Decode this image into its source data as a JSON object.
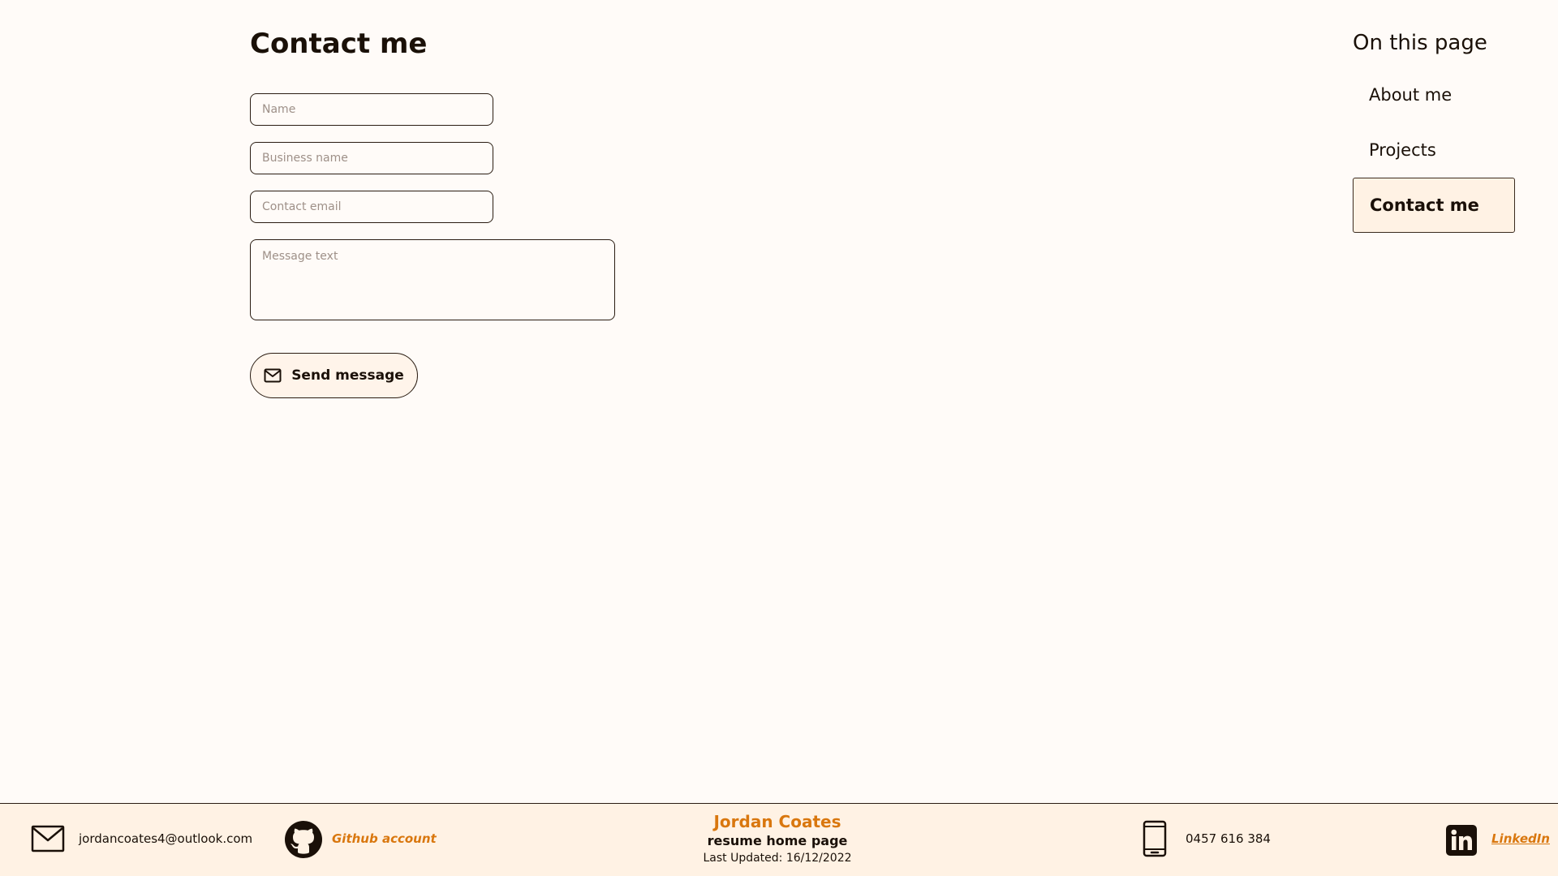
{
  "contact": {
    "title": "Contact me",
    "name_placeholder": "Name",
    "business_placeholder": "Business name",
    "email_placeholder": "Contact email",
    "message_placeholder": "Message text",
    "send_label": "Send message"
  },
  "toc": {
    "title": "On this page",
    "items": [
      {
        "label": "About me",
        "active": false
      },
      {
        "label": "Projects",
        "active": false
      },
      {
        "label": "Contact me",
        "active": true
      }
    ]
  },
  "footer": {
    "email": "jordancoates4@outlook.com",
    "github_label": "Github account",
    "name": "Jordan Coates",
    "subtitle": "resume home page",
    "last_updated": "Last Updated: 16/12/2022",
    "phone": "0457 616 384",
    "linkedin_label": "LinkedIn"
  },
  "colors": {
    "background": "#fffbf8",
    "accent": "#d9770e",
    "footer_background": "#fff2e4",
    "text": "#1a1008"
  },
  "icons": [
    "mail-icon",
    "github-icon",
    "phone-icon",
    "linkedin-icon"
  ]
}
